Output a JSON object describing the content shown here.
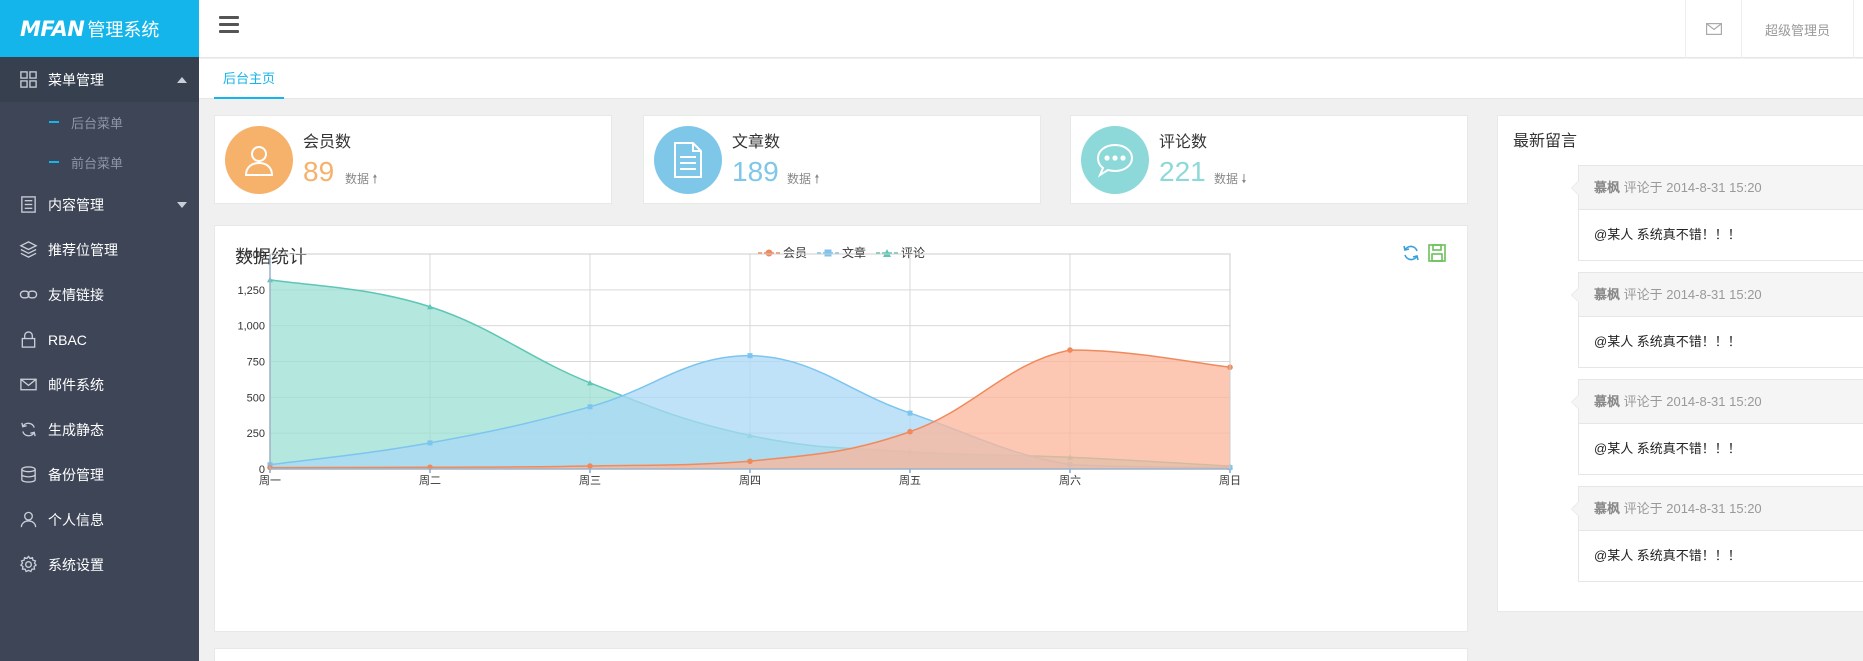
{
  "app": {
    "brand": "MFAN",
    "title_suffix": "管理系统"
  },
  "header": {
    "user_label": "超级管理员"
  },
  "sidebar": {
    "items": [
      {
        "label": "菜单管理",
        "icon": "grid-icon",
        "expanded": true,
        "children": [
          {
            "label": "后台菜单"
          },
          {
            "label": "前台菜单"
          }
        ]
      },
      {
        "label": "内容管理",
        "icon": "list-icon",
        "expanded": false
      },
      {
        "label": "推荐位管理",
        "icon": "layers-icon"
      },
      {
        "label": "友情链接",
        "icon": "link-icon"
      },
      {
        "label": "RBAC",
        "icon": "lock-icon"
      },
      {
        "label": "邮件系统",
        "icon": "mail-icon"
      },
      {
        "label": "生成静态",
        "icon": "refresh-icon"
      },
      {
        "label": "备份管理",
        "icon": "database-icon"
      },
      {
        "label": "个人信息",
        "icon": "user-icon"
      },
      {
        "label": "系统设置",
        "icon": "gear-icon"
      }
    ]
  },
  "tabs": [
    {
      "label": "后台主页",
      "active": true
    }
  ],
  "stats": [
    {
      "title": "会员数",
      "value": "89",
      "tag": "数据",
      "trend": "up",
      "icon": "user-icon",
      "color": "#f6b26b"
    },
    {
      "title": "文章数",
      "value": "189",
      "tag": "数据",
      "trend": "up",
      "icon": "document-icon",
      "color": "#7fc7e8"
    },
    {
      "title": "评论数",
      "value": "221",
      "tag": "数据",
      "trend": "down",
      "icon": "chat-icon",
      "color": "#8dd9d9"
    }
  ],
  "chart_panel": {
    "title": "数据统计"
  },
  "chart_data": {
    "type": "area",
    "title": "数据统计",
    "categories": [
      "周一",
      "周二",
      "周三",
      "周四",
      "周五",
      "周六",
      "周日"
    ],
    "ylim": [
      0,
      1500
    ],
    "yticks": [
      "0",
      "250",
      "500",
      "750",
      "1,000",
      "1,250",
      "1,500"
    ],
    "grid": true,
    "legend_position": "top-center",
    "series": [
      {
        "name": "会员",
        "values": [
          10,
          12,
          21,
          54,
          260,
          830,
          710
        ],
        "color": "#f08a5d",
        "fill": "#fcb59a",
        "marker": "circle"
      },
      {
        "name": "文章",
        "values": [
          30,
          182,
          434,
          791,
          390,
          30,
          10
        ],
        "color": "#7cc5ef",
        "fill": "#a9d8f5",
        "marker": "square"
      },
      {
        "name": "评论",
        "values": [
          1320,
          1132,
          601,
          234,
          120,
          82,
          20
        ],
        "color": "#5ec6b6",
        "fill": "#9bdfd3",
        "marker": "triangle"
      }
    ]
  },
  "messages": {
    "title": "最新留言",
    "items": [
      {
        "author": "慕枫",
        "meta": " 评论于 2014-8-31 15:20",
        "body": "@某人 系统真不错！！！"
      },
      {
        "author": "慕枫",
        "meta": " 评论于 2014-8-31 15:20",
        "body": "@某人 系统真不错！！！"
      },
      {
        "author": "慕枫",
        "meta": " 评论于 2014-8-31 15:20",
        "body": "@某人 系统真不错！！！"
      },
      {
        "author": "慕枫",
        "meta": " 评论于 2014-8-31 15:20",
        "body": "@某人 系统真不错！！！"
      }
    ]
  }
}
